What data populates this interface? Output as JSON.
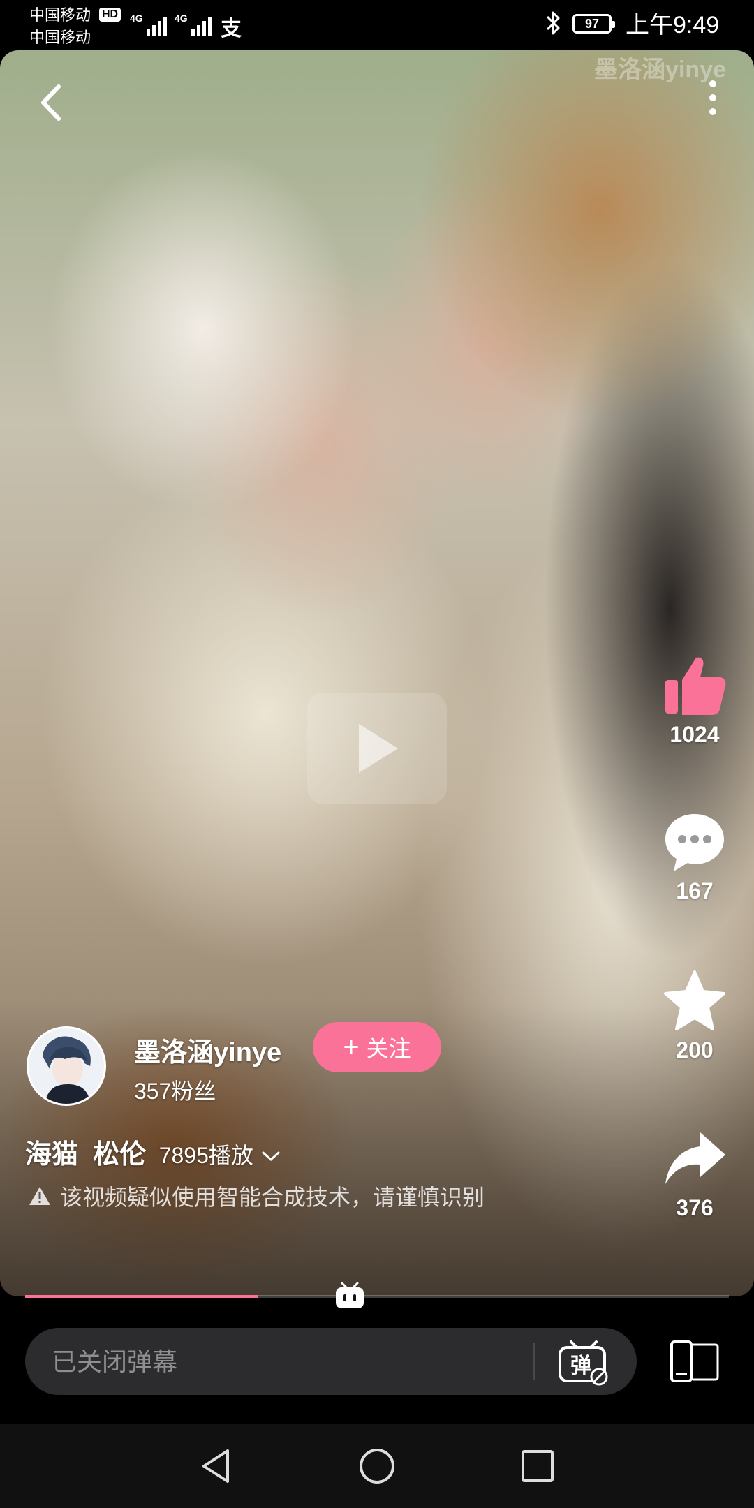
{
  "status_bar": {
    "carrier_1": "中国移动",
    "carrier_2": "中国移动",
    "hd_badge": "HD",
    "network_1": "4G",
    "network_2": "4G",
    "alipay_glyph": "支",
    "battery": "97",
    "time": "上午9:49",
    "icons": [
      "signal-icon",
      "bluetooth-icon",
      "battery-icon",
      "alipay-icon"
    ]
  },
  "video": {
    "watermark": "墨洛涵yinye",
    "back_icon": "back-arrow-icon",
    "more_icon": "more-vertical-icon",
    "center_icon": "play-icon",
    "progress_fraction": 0.33
  },
  "actions": {
    "like": {
      "icon": "thumbs-up-icon",
      "count": "1024",
      "color": "#fb7299"
    },
    "comment": {
      "icon": "comment-icon",
      "count": "167"
    },
    "favorite": {
      "icon": "star-icon",
      "count": "200"
    },
    "share": {
      "icon": "share-icon",
      "count": "376"
    }
  },
  "author": {
    "name": "墨洛涵yinye",
    "followers": "357粉丝",
    "follow_button": "关注",
    "follow_color": "#fb7299"
  },
  "video_info": {
    "title": "海猫  松伦",
    "plays": "7895播放",
    "ai_warning": "该视频疑似使用智能合成技术，请谨慎识别"
  },
  "bottom_bar": {
    "danmaku_placeholder": "已关闭弹幕",
    "danmaku_toggle_glyph": "弹",
    "danmaku_icon": "danmaku-off-icon",
    "rotate_icon": "rotate-screen-icon"
  },
  "nav": {
    "back": "nav-back-icon",
    "home": "nav-home-icon",
    "recents": "nav-recents-icon"
  }
}
